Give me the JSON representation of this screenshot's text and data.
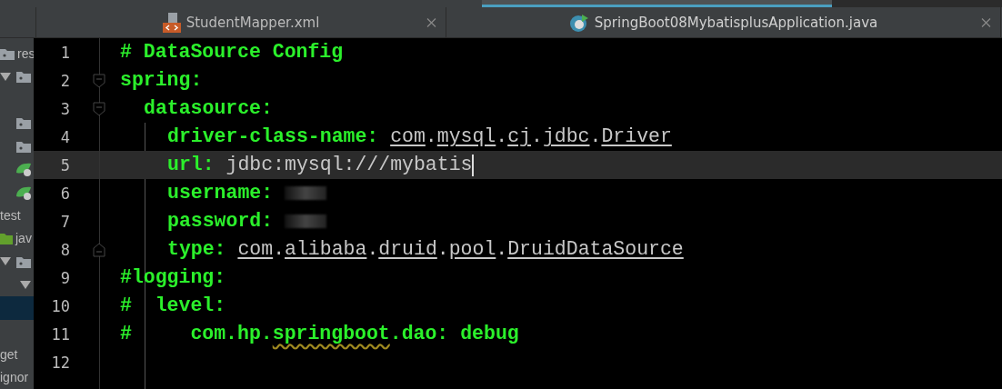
{
  "tabs": [
    {
      "label": "StudentMapper.xml",
      "kind": "xml",
      "selected": false
    },
    {
      "label": "SpringBoot08MybatisplusApplication.java",
      "kind": "java",
      "selected": true
    }
  ],
  "sidebar": {
    "items": [
      {
        "kind": "root-folder",
        "text": "res",
        "selected": false
      },
      {
        "kind": "expandable-folder",
        "selected": false
      },
      {
        "selected": false
      },
      {
        "kind": "folder",
        "selected": false
      },
      {
        "kind": "folder",
        "selected": false
      },
      {
        "kind": "spring-file",
        "selected": false
      },
      {
        "kind": "spring-file",
        "selected": false
      },
      {
        "kind": "label",
        "text": "test",
        "selected": false
      },
      {
        "kind": "source-folder",
        "text": "jav",
        "selected": false
      },
      {
        "kind": "expandable-folder",
        "selected": false
      },
      {
        "kind": "arrow",
        "selected": false
      },
      {
        "selected": true
      },
      {
        "selected": false
      },
      {
        "kind": "label",
        "text": "get",
        "selected": false
      },
      {
        "kind": "label",
        "text": "ignor",
        "selected": false
      }
    ]
  },
  "editor": {
    "lines": [
      {
        "number": "1",
        "current": false,
        "segments": [
          {
            "text": "# DataSource Config",
            "kind": "comment"
          }
        ]
      },
      {
        "number": "2",
        "current": false,
        "segments": [
          {
            "text": "spring:",
            "kind": "key"
          }
        ],
        "children": [
          {
            "number": "3",
            "current": false,
            "segments": [
              {
                "text": "datasource:",
                "kind": "key"
              }
            ],
            "children": [
              {
                "number": "4",
                "current": false,
                "segments": [
                  {
                    "text": "driver-class-name: ",
                    "kind": "key"
                  },
                  {
                    "text": "com",
                    "kind": "ref"
                  },
                  {
                    "text": ".",
                    "kind": "value"
                  },
                  {
                    "text": "mysql",
                    "kind": "ref"
                  },
                  {
                    "text": ".",
                    "kind": "value"
                  },
                  {
                    "text": "cj",
                    "kind": "ref"
                  },
                  {
                    "text": ".",
                    "kind": "value"
                  },
                  {
                    "text": "jdbc",
                    "kind": "ref"
                  },
                  {
                    "text": ".",
                    "kind": "value"
                  },
                  {
                    "text": "Driver",
                    "kind": "ref"
                  }
                ]
              },
              {
                "number": "5",
                "current": true,
                "segments": [
                  {
                    "text": "url: ",
                    "kind": "key"
                  },
                  {
                    "text": "jdbc:mysql:///mybatis",
                    "kind": "value"
                  }
                ]
              },
              {
                "number": "6",
                "current": false,
                "segments": [
                  {
                    "text": "username: ",
                    "kind": "key"
                  },
                  {
                    "kind": "redacted"
                  }
                ]
              },
              {
                "number": "7",
                "current": false,
                "segments": [
                  {
                    "text": "password: ",
                    "kind": "key"
                  },
                  {
                    "kind": "redacted"
                  }
                ]
              },
              {
                "number": "8",
                "current": false,
                "segments": [
                  {
                    "text": "type: ",
                    "kind": "key"
                  },
                  {
                    "text": "com",
                    "kind": "ref"
                  },
                  {
                    "text": ".",
                    "kind": "value"
                  },
                  {
                    "text": "alibaba",
                    "kind": "ref"
                  },
                  {
                    "text": ".",
                    "kind": "value"
                  },
                  {
                    "text": "druid",
                    "kind": "ref"
                  },
                  {
                    "text": ".",
                    "kind": "value"
                  },
                  {
                    "text": "pool",
                    "kind": "ref"
                  },
                  {
                    "text": ".",
                    "kind": "value"
                  },
                  {
                    "text": "DruidDataSource",
                    "kind": "ref"
                  }
                ]
              }
            ]
          }
        ]
      },
      {
        "number": "9",
        "current": false,
        "segments": [
          {
            "text": "#logging:",
            "kind": "comment"
          }
        ]
      },
      {
        "number": "10",
        "current": false,
        "segments": [
          {
            "text": "#  level:",
            "kind": "comment"
          }
        ]
      },
      {
        "number": "11",
        "current": false,
        "segments": [
          {
            "text": "#     com.hp.",
            "kind": "comment"
          },
          {
            "text": "springboot",
            "kind": "warn"
          },
          {
            "text": ".dao: debug",
            "kind": "comment"
          }
        ]
      },
      {
        "number": "12",
        "current": false
      }
    ]
  }
}
